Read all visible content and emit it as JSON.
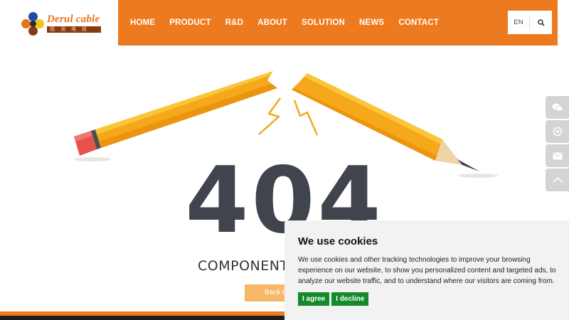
{
  "brand": {
    "name": "Derul cable",
    "subtitle": "德 润 电 缆"
  },
  "nav": {
    "items": [
      "HOME",
      "PRODUCT",
      "R&D",
      "ABOUT",
      "SOLUTION",
      "NEWS",
      "CONTACT"
    ],
    "lang": "EN"
  },
  "error": {
    "code": "404",
    "message": "COMPONENT",
    "back_button": "Back to"
  },
  "side_buttons": [
    "wechat-icon",
    "whatsapp-icon",
    "email-icon",
    "back-to-top-icon"
  ],
  "cookie": {
    "title": "We use cookies",
    "text": "We use cookies and other tracking technologies to improve your browsing experience on our website, to show you personalized content and targeted ads, to analyze our website traffic, and to understand where our visitors are coming from.",
    "agree": "I agree",
    "decline": "I decline"
  },
  "colors": {
    "accent": "#ee7a1f",
    "cookie_button": "#148a2b",
    "code_text": "#3f444d"
  }
}
